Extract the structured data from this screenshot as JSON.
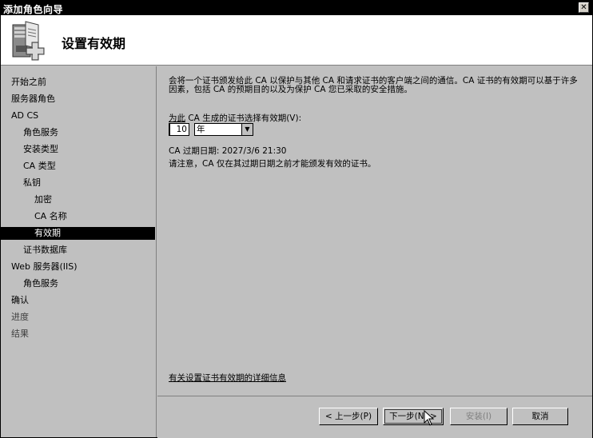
{
  "window": {
    "title": "添加角色向导",
    "close_glyph": "✕"
  },
  "header": {
    "title": "设置有效期",
    "icon": "server-role-wizard-icon"
  },
  "nav": {
    "items": [
      {
        "label": "开始之前",
        "state": "normal"
      },
      {
        "label": "服务器角色",
        "state": "normal"
      },
      {
        "label": "AD CS",
        "state": "normal"
      },
      {
        "label": "角色服务",
        "state": "normal"
      },
      {
        "label": "安装类型",
        "state": "normal"
      },
      {
        "label": "CA 类型",
        "state": "normal"
      },
      {
        "label": "私钥",
        "state": "normal"
      },
      {
        "label": "加密",
        "state": "normal"
      },
      {
        "label": "CA 名称",
        "state": "normal"
      },
      {
        "label": "有效期",
        "state": "active"
      },
      {
        "label": "证书数据库",
        "state": "normal"
      },
      {
        "label": "Web 服务器(IIS)",
        "state": "normal"
      },
      {
        "label": "角色服务",
        "state": "normal"
      },
      {
        "label": "确认",
        "state": "normal"
      },
      {
        "label": "进度",
        "state": "dim"
      },
      {
        "label": "结果",
        "state": "dim"
      }
    ]
  },
  "content": {
    "description": "会将一个证书颁发给此 CA 以保护与其他 CA 和请求证书的客户端之间的通信。CA 证书的有效期可以基于许多因素，包括 CA 的预期目的以及为保护 CA 您已采取的安全措施。",
    "validity_label_prefix": "为此",
    "validity_label_rest": " CA 生成的证书选择有效期(V):",
    "validity_value": "10",
    "unit_selected": "年",
    "expiry_text": "CA 过期日期:  2027/3/6 21:30",
    "note_text": "请注意，CA 仅在其过期日期之前才能颁发有效的证书。",
    "more_info_link": "有关设置证书有效期的详细信息"
  },
  "footer": {
    "back_label": "< 上一步(P)",
    "next_label": "下一步(N) >",
    "install_label": "安装(I)",
    "cancel_label": "取消"
  },
  "colors": {
    "window_bg": "#c0c0c0",
    "titlebar_bg": "#000000",
    "active_nav_bg": "#000000",
    "header_bg": "#ffffff"
  }
}
